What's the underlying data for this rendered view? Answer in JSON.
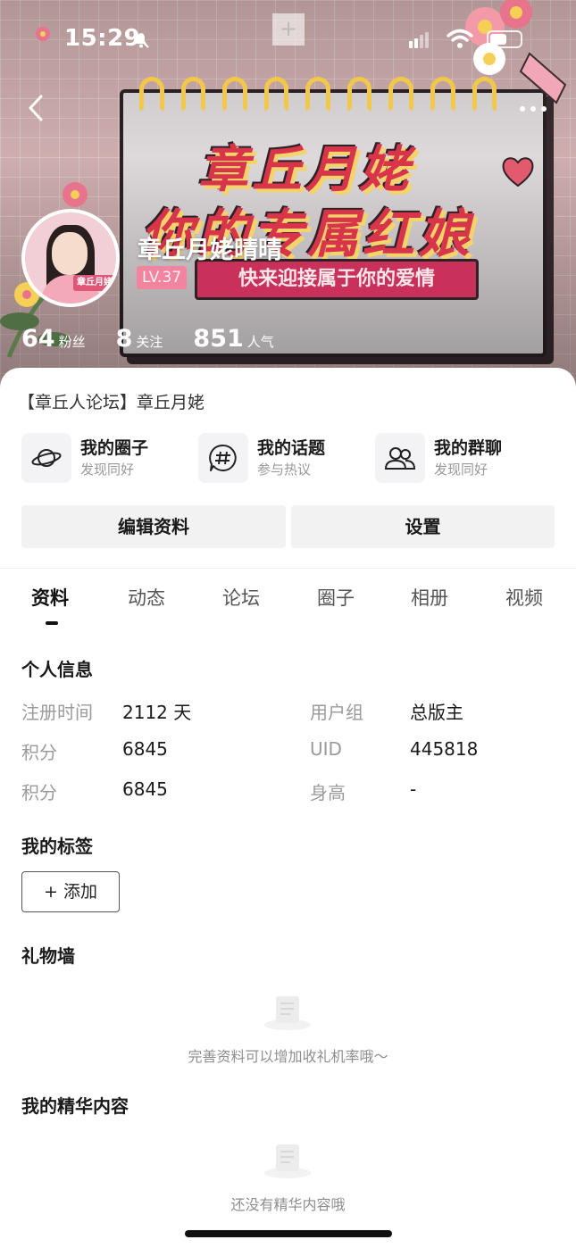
{
  "status_bar": {
    "time": "15:29"
  },
  "header": {
    "plus_label": "+",
    "poster": {
      "line1": "章丘月姥",
      "line2": "你的专属红娘",
      "ribbon": "快来迎接属于你的爱情"
    },
    "avatar_tag": "章丘月姥",
    "username": "章丘月姥晴晴",
    "level": "LV.37",
    "stats": [
      {
        "value": "64",
        "label": "粉丝"
      },
      {
        "value": "8",
        "label": "关注"
      },
      {
        "value": "851",
        "label": "人气"
      }
    ]
  },
  "profile": {
    "forum_line": "【章丘人论坛】章丘月姥",
    "shortcuts": [
      {
        "icon": "planet-icon",
        "title": "我的圈子",
        "sub": "发现同好"
      },
      {
        "icon": "hashtag-bubble-icon",
        "title": "我的话题",
        "sub": "参与热议"
      },
      {
        "icon": "group-people-icon",
        "title": "我的群聊",
        "sub": "发现同好"
      }
    ],
    "edit_label": "编辑资料",
    "settings_label": "设置"
  },
  "tabs": [
    "资料",
    "动态",
    "论坛",
    "圈子",
    "相册",
    "视频"
  ],
  "active_tab": "资料",
  "personal_info": {
    "title": "个人信息",
    "rows": [
      {
        "l1": "注册时间",
        "v1": "2112 天",
        "l2": "用户组",
        "v2": "总版主"
      },
      {
        "l1": "积分",
        "v1": "6845",
        "l2": "UID",
        "v2": "445818"
      },
      {
        "l1": "积分",
        "v1": "6845",
        "l2": "身高",
        "v2": "-"
      }
    ]
  },
  "tags_section": {
    "title": "我的标签",
    "add_label": "+ 添加"
  },
  "gift_wall": {
    "title": "礼物墙",
    "empty_text": "完善资料可以增加收礼机率哦～"
  },
  "featured": {
    "title": "我的精华内容",
    "empty_text": "还没有精华内容哦"
  },
  "colors": {
    "accent_pink": "#f3849f",
    "poster_red": "#d8344a",
    "muted": "#9a9a9a"
  }
}
